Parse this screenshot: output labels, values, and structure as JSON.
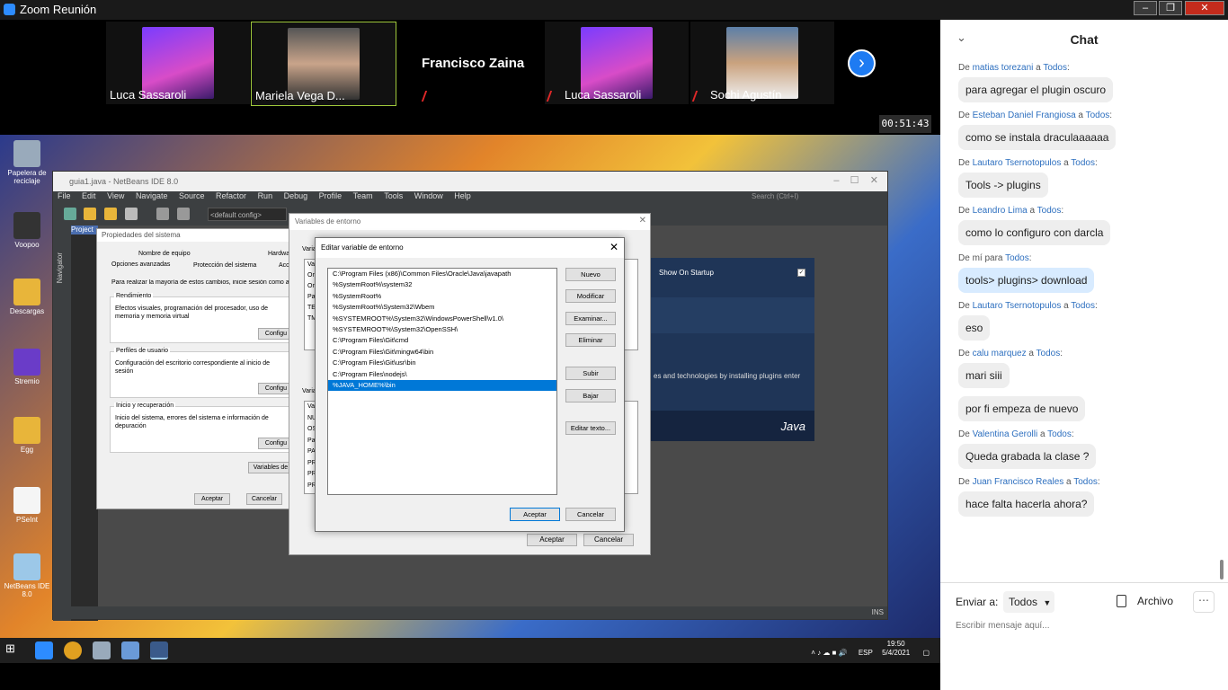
{
  "zoom": {
    "window_title": "Zoom Reunión",
    "timer": "00:51:43",
    "participants": [
      {
        "name": "Luca Sassaroli",
        "muted": false
      },
      {
        "name": "Mariela Vega D...",
        "muted": false
      },
      {
        "name": "Francisco Zaina",
        "muted": true
      },
      {
        "name": "Luca Sassaroli",
        "muted": true
      },
      {
        "name": "Sochi Agustín",
        "muted": true
      }
    ]
  },
  "desktop": {
    "icons": [
      {
        "label": "Papelera de reciclaje"
      },
      {
        "label": "Voopoo"
      },
      {
        "label": "Descargas"
      },
      {
        "label": "Stremio"
      },
      {
        "label": "Egg"
      },
      {
        "label": "PSeInt"
      },
      {
        "label": "NetBeans IDE 8.0"
      }
    ]
  },
  "netbeans": {
    "title": "guia1.java - NetBeans IDE 8.0",
    "menu": [
      "File",
      "Edit",
      "View",
      "Navigate",
      "Source",
      "Refactor",
      "Run",
      "Debug",
      "Profile",
      "Team",
      "Tools",
      "Window",
      "Help"
    ],
    "search_placeholder": "Search (Ctrl+I)",
    "config": "<default config>",
    "projects_tab": "Project",
    "navigator": "Navigator",
    "show_on_startup": "Show On Startup",
    "plugins_text": "es and technologies by installing plugins enter",
    "java_logo": "Java",
    "status_ins": "INS"
  },
  "sysprops": {
    "title": "Propiedades del sistema",
    "tabs_top": [
      "Nombre de equipo",
      "Hardwa"
    ],
    "tabs_bottom": [
      "Opciones avanzadas",
      "Protección del sistema",
      "Acc"
    ],
    "intro": "Para realizar la mayoría de estos cambios, inicie sesión como adi",
    "groups": [
      {
        "title": "Rendimiento",
        "text": "Efectos visuales, programación del procesador, uso de memoria y memoria virtual",
        "button": "Configu"
      },
      {
        "title": "Perfiles de usuario",
        "text": "Configuración del escritorio correspondiente al inicio de sesión",
        "button": "Configu"
      },
      {
        "title": "Inicio y recuperación",
        "text": "Inicio del sistema, errores del sistema e información de depuración",
        "button": "Configu"
      }
    ],
    "env_button": "Variables de",
    "ok": "Aceptar",
    "cancel": "Cancelar"
  },
  "envvars": {
    "title": "Variables de entorno",
    "user_label": "Varia",
    "system_label": "Varia",
    "user_vars": [
      "Va",
      "On",
      "On",
      "Pa",
      "TE",
      "TM"
    ],
    "system_vars": [
      "Va",
      "NU",
      "OS",
      "Pa",
      "PA",
      "PR",
      "PR",
      "PR"
    ],
    "ok": "Aceptar",
    "cancel": "Cancelar"
  },
  "editvar": {
    "title": "Editar variable de entorno",
    "paths": [
      "C:\\Program Files (x86)\\Common Files\\Oracle\\Java\\javapath",
      "%SystemRoot%\\system32",
      "%SystemRoot%",
      "%SystemRoot%\\System32\\Wbem",
      "%SYSTEMROOT%\\System32\\WindowsPowerShell\\v1.0\\",
      "%SYSTEMROOT%\\System32\\OpenSSH\\",
      "C:\\Program Files\\Git\\cmd",
      "C:\\Program Files\\Git\\mingw64\\bin",
      "C:\\Program Files\\Git\\usr\\bin",
      "C:\\Program Files\\nodejs\\",
      "%JAVA_HOME%\\bin"
    ],
    "buttons": {
      "new": "Nuevo",
      "edit": "Modificar",
      "browse": "Examinar...",
      "delete": "Eliminar",
      "up": "Subir",
      "down": "Bajar",
      "edit_text": "Editar texto..."
    },
    "ok": "Aceptar",
    "cancel": "Cancelar"
  },
  "taskbar": {
    "lang": "ESP",
    "time": "19:50",
    "date": "5/4/2021"
  },
  "chat": {
    "title": "Chat",
    "messages": [
      {
        "from": "matias torezani",
        "to": "Todos",
        "text": "para agregar el plugin oscuro"
      },
      {
        "from": "Esteban Daniel Frangiosa",
        "to": "Todos",
        "text": "como se instala draculaaaaaa"
      },
      {
        "from": "Lautaro Tsernotopulos",
        "to": "Todos",
        "text": "Tools -> plugins"
      },
      {
        "from": "Leandro Lima",
        "to": "Todos",
        "text": "como lo configuro con darcla"
      },
      {
        "from": "mí",
        "to": "Todos",
        "text": "tools> plugins> download",
        "mine": true
      },
      {
        "from": "Lautaro Tsernotopulos",
        "to": "Todos",
        "text": "eso"
      },
      {
        "from": "calu marquez",
        "to": "Todos",
        "text": "mari siii",
        "extra": "por fi empeza de nuevo"
      },
      {
        "from": "Valentina Gerolli",
        "to": "Todos",
        "text": "Queda grabada la clase ?"
      },
      {
        "from": "Juan Francisco Reales",
        "to": "Todos",
        "text": "hace falta hacerla ahora?"
      }
    ],
    "send_to_label": "Enviar a:",
    "send_to_value": "Todos",
    "file_label": "Archivo",
    "input_placeholder": "Escribir mensaje aquí..."
  }
}
